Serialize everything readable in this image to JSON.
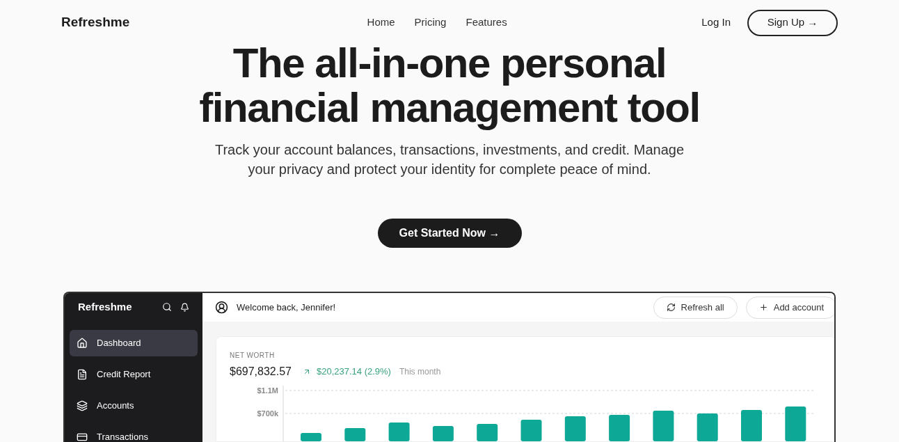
{
  "header": {
    "logo": "Refreshme",
    "nav": [
      "Home",
      "Pricing",
      "Features"
    ],
    "login": "Log In",
    "signup": "Sign Up →"
  },
  "hero": {
    "title_lines": [
      "The all-in-one personal",
      "financial management tool"
    ],
    "subtitle_lines": [
      "Track your account balances, transactions, investments, and credit. Manage",
      "your privacy and protect your identity for complete peace of mind."
    ],
    "cta": "Get Started Now →"
  },
  "app": {
    "sidebar": {
      "logo": "Refreshme",
      "items": [
        {
          "label": "Dashboard",
          "selected": true
        },
        {
          "label": "Credit Report",
          "selected": false
        },
        {
          "label": "Accounts",
          "selected": false
        },
        {
          "label": "Transactions",
          "selected": false
        }
      ]
    },
    "topbar": {
      "welcome": "Welcome back, Jennifer!",
      "buttons": [
        "Refresh all",
        "Add account"
      ]
    },
    "net_worth": {
      "label": "NET WORTH",
      "value": "$697,832.57",
      "change": "$20,237.14 (2.9%)",
      "period": "This month",
      "chart": {
        "kind": "picture",
        "axis_labels": [
          "$1.1M",
          "$700k"
        ]
      }
    }
  }
}
